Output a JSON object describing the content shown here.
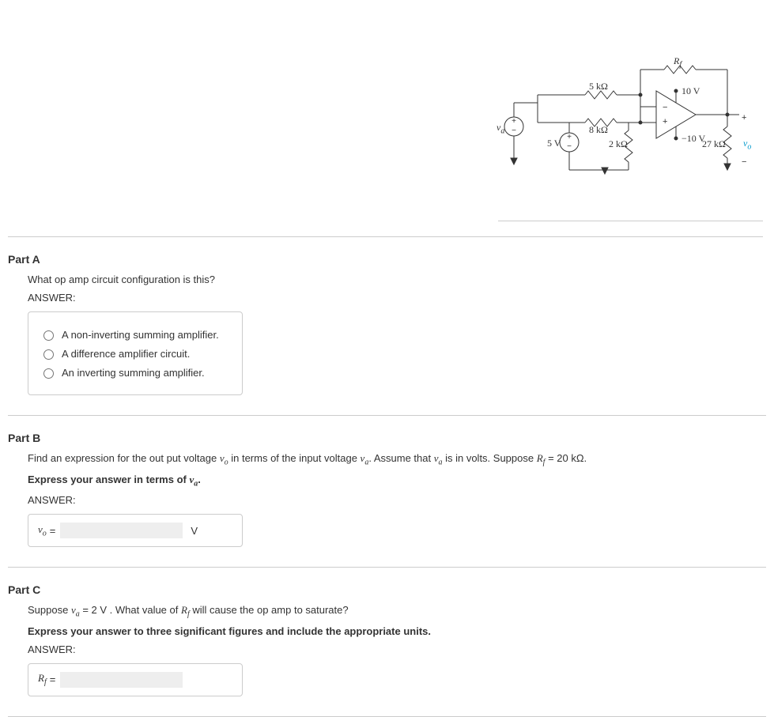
{
  "figure": {
    "rf": "R",
    "rf_sub": "f",
    "r5k": "5 kΩ",
    "r8k": "8 kΩ",
    "r2k": "2 kΩ",
    "r27k": "27 kΩ",
    "v10": "10 V",
    "vneg10": "−10 V",
    "v5": "5 V",
    "va": "v",
    "va_sub": "a",
    "vo": "v",
    "vo_sub": "o",
    "plus": "+",
    "minus": "−"
  },
  "partA": {
    "title": "Part A",
    "question": "What op amp circuit configuration is this?",
    "answer_label": "ANSWER:",
    "choices": [
      "A non-inverting summing amplifier.",
      "A difference amplifier circuit.",
      "An inverting summing amplifier."
    ]
  },
  "partB": {
    "title": "Part B",
    "question_pre": "Find an expression for the out put voltage ",
    "vo": "v",
    "vo_sub": "o",
    "question_mid1": " in terms of the input voltage ",
    "va": "v",
    "va_sub": "a",
    "question_mid2": ". Assume that ",
    "question_mid3": " is in volts. Suppose ",
    "rf": "R",
    "rf_sub": "f",
    "rf_val": " = 20 kΩ.",
    "instr_pre": "Express your answer in terms of ",
    "instr_post": ".",
    "answer_label": "ANSWER:",
    "lhs": "v",
    "lhs_sub": "o",
    "eq": " = ",
    "unit": "V"
  },
  "partC": {
    "title": "Part C",
    "question_pre": "Suppose ",
    "va": "v",
    "va_sub": "a",
    "va_val": " = 2  V . What value of ",
    "rf": "R",
    "rf_sub": "f",
    "question_post": " will cause the op amp to saturate?",
    "instr": "Express your answer to three significant figures and include the appropriate units.",
    "answer_label": "ANSWER:",
    "lhs": "R",
    "lhs_sub": "f",
    "eq": " = "
  }
}
